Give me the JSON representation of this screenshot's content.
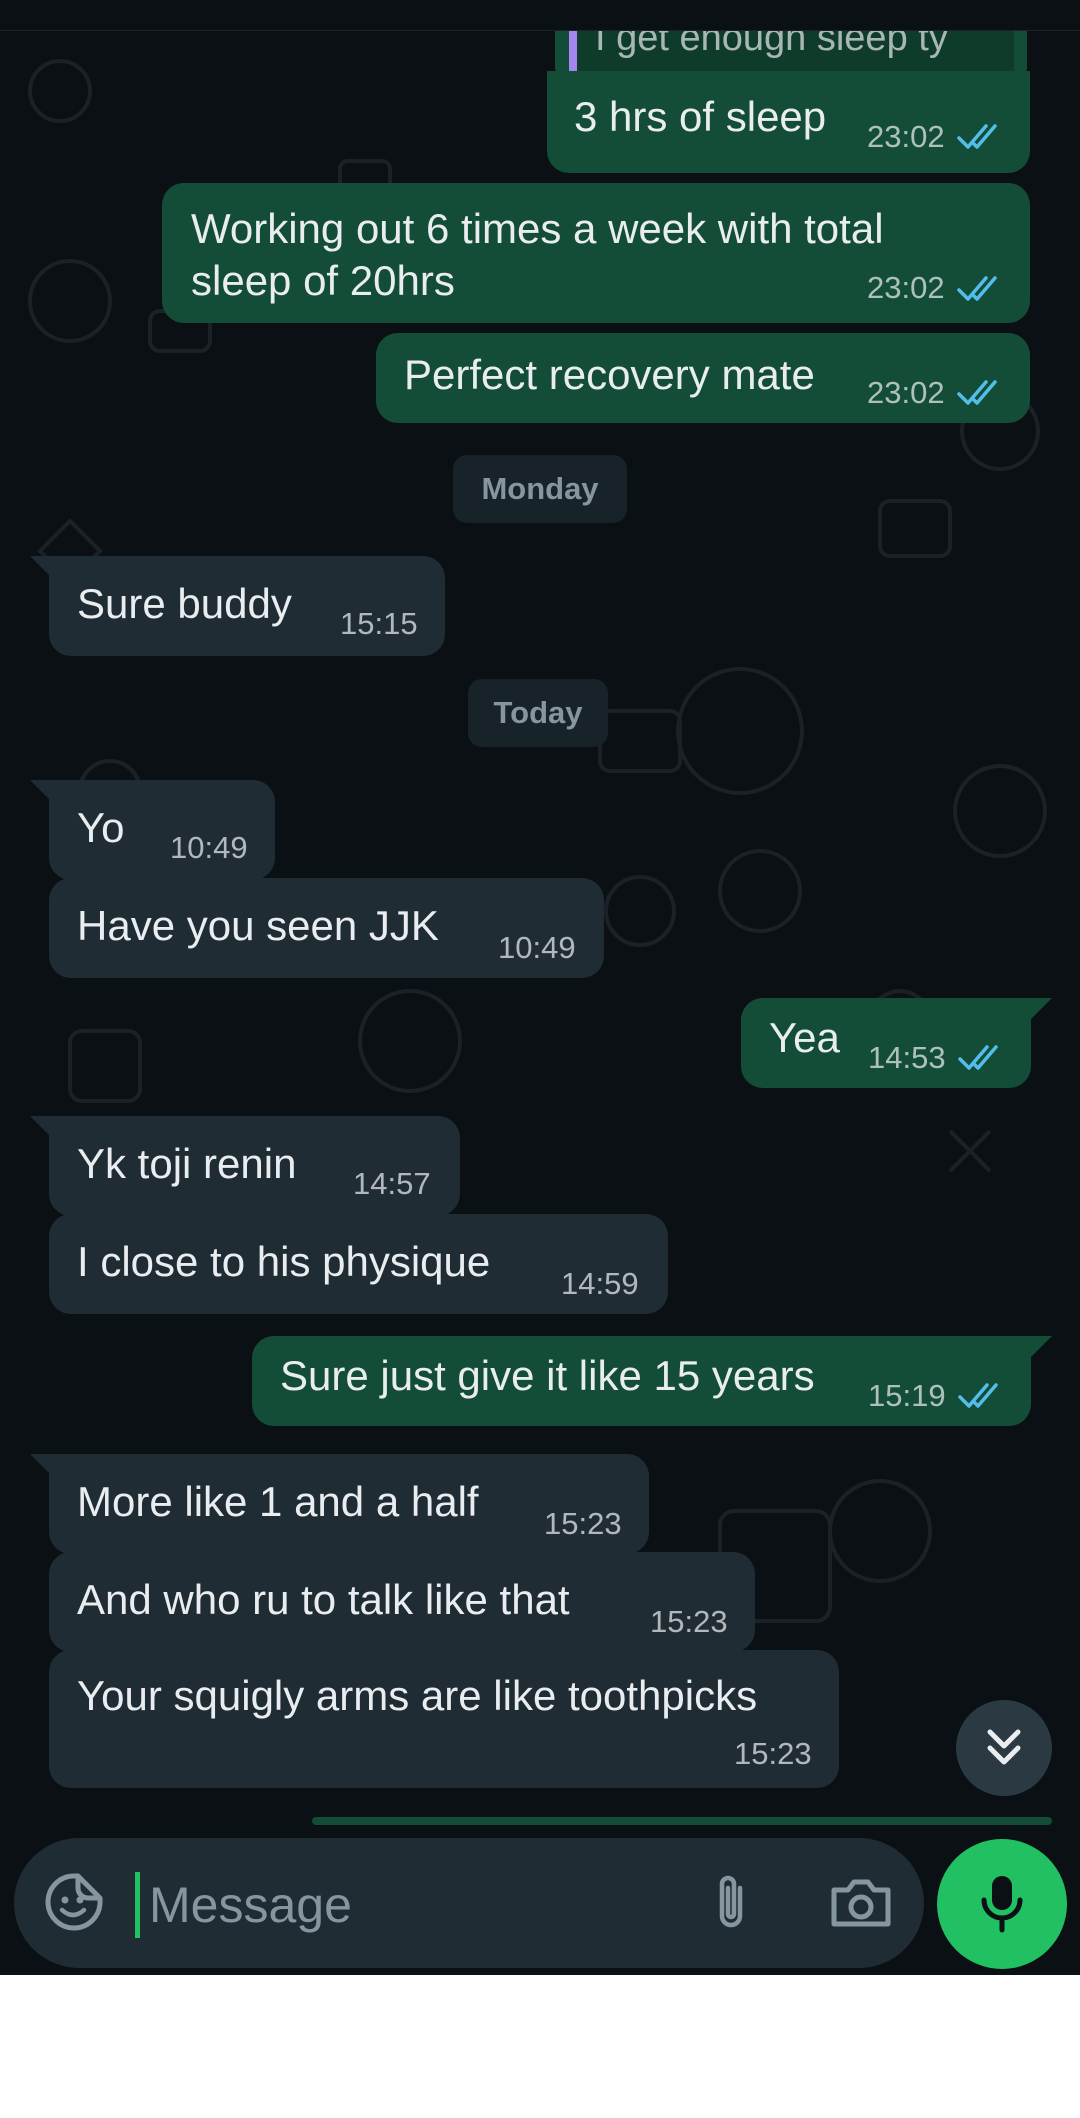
{
  "colors": {
    "background": "#0b1014",
    "incoming_bubble": "#202c33",
    "outgoing_bubble": "#144d37",
    "read_ticks": "#53bdeb",
    "accent_green": "#21c063",
    "quote_bar": "#a387ee"
  },
  "quoted_message": {
    "text": "I get enough sleep ty"
  },
  "messages": [
    {
      "direction": "out",
      "text": "3 hrs of sleep",
      "time": "23:02",
      "status": "read"
    },
    {
      "direction": "out",
      "text_line1": "Working out 6 times a week with total",
      "text_line2": "sleep of 20hrs",
      "time": "23:02",
      "status": "read"
    },
    {
      "direction": "out",
      "text": "Perfect recovery mate",
      "time": "23:02",
      "status": "read"
    },
    {
      "direction": "in",
      "text": "Sure buddy",
      "time": "15:15"
    },
    {
      "direction": "in",
      "text": "Yo",
      "time": "10:49"
    },
    {
      "direction": "in",
      "text": "Have you seen JJK",
      "time": "10:49"
    },
    {
      "direction": "out",
      "text": "Yea",
      "time": "14:53",
      "status": "read"
    },
    {
      "direction": "in",
      "text": "Yk toji renin",
      "time": "14:57"
    },
    {
      "direction": "in",
      "text": "I close to his physique",
      "time": "14:59"
    },
    {
      "direction": "out",
      "text": "Sure just give it like 15 years",
      "time": "15:19",
      "status": "read"
    },
    {
      "direction": "in",
      "text": "More like 1 and a half",
      "time": "15:23"
    },
    {
      "direction": "in",
      "text": "And who ru to talk like that",
      "time": "15:23"
    },
    {
      "direction": "in",
      "text": "Your squigly arms are like toothpicks",
      "time": "15:23"
    }
  ],
  "date_separators": [
    "Monday",
    "Today"
  ],
  "composer": {
    "placeholder": "Message",
    "emoji_icon": "sticker-emoji-icon",
    "attach_icon": "paperclip-icon",
    "camera_icon": "camera-icon",
    "mic_icon": "microphone-icon"
  },
  "scroll_button_icon": "double-chevron-down-icon"
}
